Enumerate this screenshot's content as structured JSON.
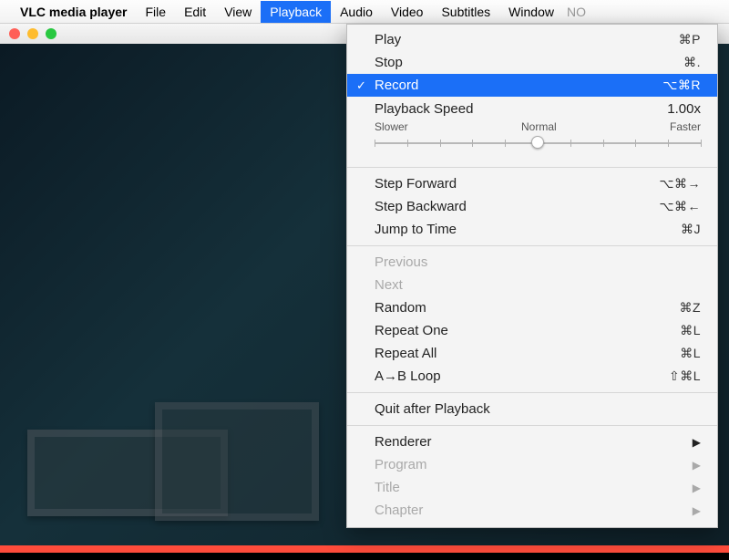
{
  "menubar": {
    "app_name": "VLC media player",
    "items": [
      "File",
      "Edit",
      "View",
      "Playback",
      "Audio",
      "Video",
      "Subtitles",
      "Window"
    ],
    "active_index": 3,
    "truncated_right": "NO"
  },
  "dropdown": {
    "play": {
      "label": "Play",
      "shortcut": "⌘P"
    },
    "stop": {
      "label": "Stop",
      "shortcut": "⌘."
    },
    "record": {
      "label": "Record",
      "shortcut": "⌥⌘R"
    },
    "speed": {
      "label": "Playback Speed",
      "value": "1.00x",
      "slower": "Slower",
      "normal": "Normal",
      "faster": "Faster",
      "pos_pct": 50
    },
    "step_fwd": {
      "label": "Step Forward",
      "shortcut": "⌥⌘→"
    },
    "step_bwd": {
      "label": "Step Backward",
      "shortcut": "⌥⌘←"
    },
    "jump": {
      "label": "Jump to Time",
      "shortcut": "⌘J"
    },
    "previous": {
      "label": "Previous",
      "shortcut": ""
    },
    "next": {
      "label": "Next",
      "shortcut": ""
    },
    "random": {
      "label": "Random",
      "shortcut": "⌘Z"
    },
    "repeat_one": {
      "label": "Repeat One",
      "shortcut": "⌘L"
    },
    "repeat_all": {
      "label": "Repeat All",
      "shortcut": "⌘L"
    },
    "ab_loop": {
      "label": "A→B Loop",
      "shortcut": "⇧⌘L"
    },
    "quit_after": {
      "label": "Quit after Playback",
      "shortcut": ""
    },
    "renderer": {
      "label": "Renderer"
    },
    "program": {
      "label": "Program"
    },
    "title": {
      "label": "Title"
    },
    "chapter": {
      "label": "Chapter"
    }
  }
}
